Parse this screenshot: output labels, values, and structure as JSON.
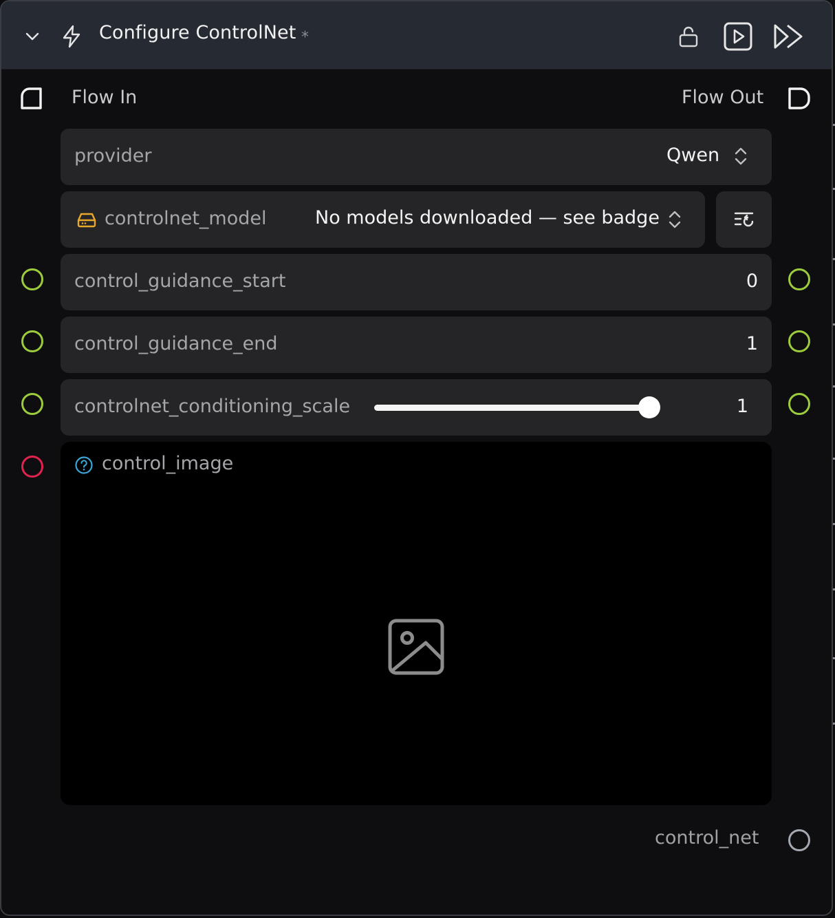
{
  "header": {
    "title": "Configure ControlNet",
    "modified_marker": "*",
    "icons": [
      "chevron-down-icon",
      "lightning-icon",
      "unlock-icon",
      "play-square-icon",
      "fast-forward-icon"
    ]
  },
  "flow": {
    "in_label": "Flow In",
    "out_label": "Flow Out"
  },
  "params": {
    "provider": {
      "label": "provider",
      "value": "Qwen"
    },
    "controlnet_model": {
      "label": "controlnet_model",
      "value": "No models downloaded — see badge"
    },
    "control_guidance_start": {
      "label": "control_guidance_start",
      "value": "0"
    },
    "control_guidance_end": {
      "label": "control_guidance_end",
      "value": "1"
    },
    "controlnet_conditioning_scale": {
      "label": "controlnet_conditioning_scale",
      "value": "1",
      "slider_fraction": 1.0
    },
    "control_image": {
      "label": "control_image"
    }
  },
  "output": {
    "label": "control_net"
  },
  "colors": {
    "handle_number": "#9ccc3c",
    "handle_image": "#e0234e",
    "handle_output": "#a4a8b0",
    "warning_icon": "#e8a92a",
    "help_icon": "#3aa6d8",
    "header_bg": "#262a33"
  }
}
